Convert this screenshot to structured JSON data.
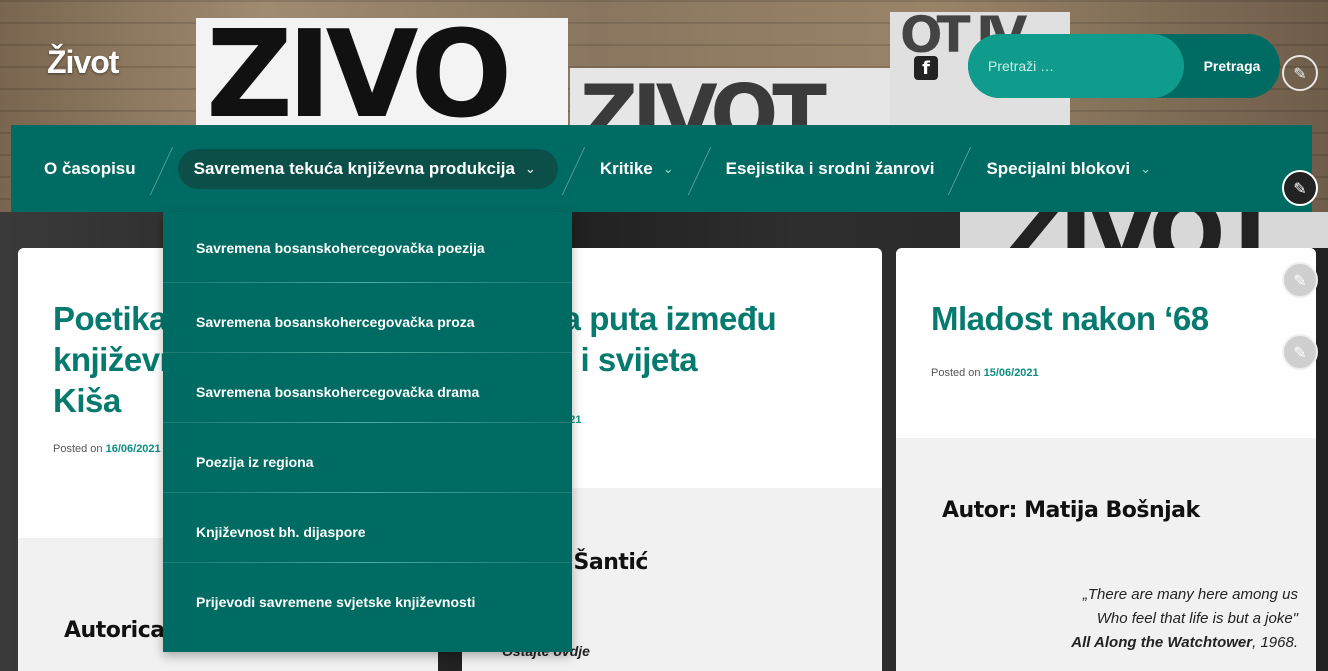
{
  "header": {
    "site_title": "Život",
    "poster_text_1": "ZIVO",
    "poster_text_2": "ZIVOT",
    "poster_text_3": "OT IV",
    "poster_text_4": "ZIVOT",
    "facebook_icon": "f",
    "search": {
      "placeholder": "Pretraži …",
      "button_label": "Pretraga"
    },
    "edit_icon": "✎"
  },
  "nav": {
    "items": [
      {
        "label": "O časopisu",
        "has_submenu": false
      },
      {
        "label": "Savremena tekuća književna produkcija",
        "has_submenu": true,
        "active": true
      },
      {
        "label": "Kritike",
        "has_submenu": true
      },
      {
        "label": "Esejistika i srodni žanrovi",
        "has_submenu": false
      },
      {
        "label": "Specijalni blokovi",
        "has_submenu": true
      }
    ],
    "chevron": "⌄"
  },
  "dropdown": {
    "items": [
      "Savremena bosanskohercegovačka poezija",
      "Savremena bosanskohercegovačka proza",
      "Savremena bosanskohercegovačka drama",
      "Poezija iz regiona",
      "Književnost bh. dijaspore",
      "Prijevodi savremene svjetske književnosti"
    ]
  },
  "posts": [
    {
      "title_lines": [
        "Poetika",
        "književn",
        "Kiša"
      ],
      "posted_label": "Posted on",
      "date": "16/06/2021",
      "author": "Autorica:"
    },
    {
      "title_lines": [
        "la puta između",
        "e i svijeta"
      ],
      "date_fragment": "/2021",
      "author_fragment": "a Šantić",
      "excerpt_fragment": "Ostajte ovdje"
    },
    {
      "title": "Mladost nakon ‘68",
      "posted_label": "Posted on",
      "date": "15/06/2021",
      "author": "Autor: Matija Bošnjak",
      "quote_lines": [
        "„There are many here among us",
        "Who feel that life is but a joke\""
      ],
      "quote_source": "All Along the Watchtower",
      "quote_year": ", 1968."
    }
  ],
  "colors": {
    "nav_bg": "#006b62",
    "nav_active": "#0c4f49",
    "title_teal": "#067a6f",
    "search_input": "#0f9c8c"
  }
}
